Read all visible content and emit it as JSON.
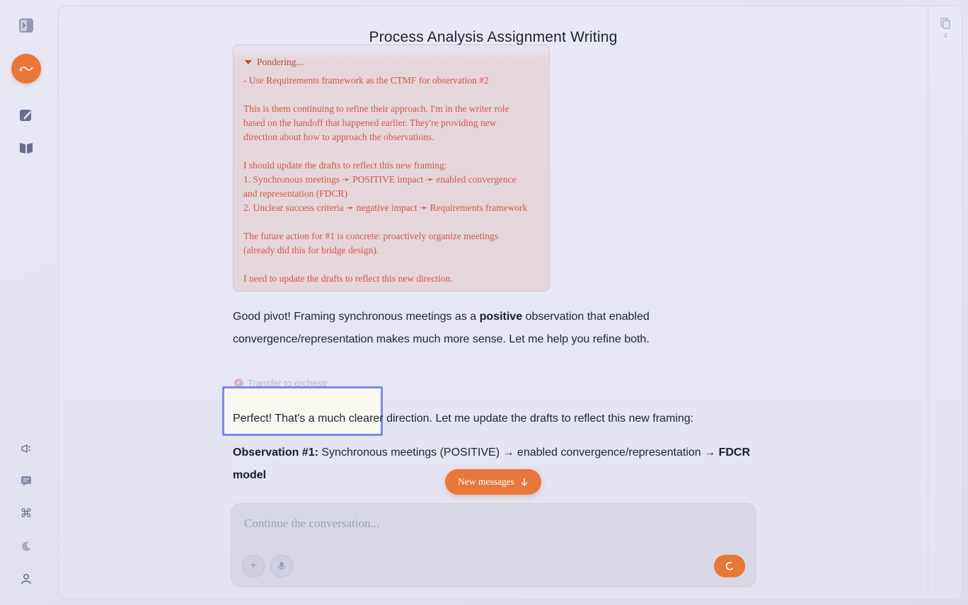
{
  "rail": {
    "icons": [
      "sidebar-toggle-icon",
      "new-chat-icon",
      "compose-icon",
      "library-icon",
      "announcement-icon",
      "feedback-icon",
      "command-icon",
      "moon-icon",
      "user-icon"
    ]
  },
  "header": {
    "title": "Process Analysis Assignment Writing"
  },
  "sidepanel": {
    "count": "4"
  },
  "thinking": {
    "label": "Pondering...",
    "lines": [
      "- Use Requirements framework as the CTMF for observation #2",
      "",
      "This is them continuing to refine their approach. I'm in the writer role",
      "based on the handoff that happened earlier. They're providing new",
      "direction about how to approach the observations.",
      "",
      "I should update the drafts to reflect this new framing:",
      "1. Synchronous meetings ➛ POSITIVE impact ➛ enabled convergence",
      "and representation (FDCR)",
      "2. Unclear success criteria ➛ negative impact ➛ Requirements framework",
      "",
      "The future action for #1 is concrete: proactively organize meetings",
      "(already did this for bridge design).",
      "",
      "I need to update the drafts to reflect this new direction."
    ]
  },
  "messages": {
    "m1_pre": "Good pivot! Framing synchronous meetings as a ",
    "m1_bold": "positive",
    "m1_post": " observation that enabled",
    "m1_line2": "convergence/representation makes much more sense. Let me help you refine both.",
    "tool_label": "Transfer to orchestr",
    "m2_pre": "Perfect! That's a much clearer",
    "m2_post": " direction. Let me update the drafts to reflect this new framing:",
    "obs_label": "Observation #1:",
    "obs_text": " Synchronous meetings (POSITIVE) → enabled convergence/representation → ",
    "obs_bold": "FDCR",
    "obs_line2": "model"
  },
  "new_messages_label": "New messages",
  "composer": {
    "placeholder": "Continue the conversation..."
  },
  "colors": {
    "accent": "#e8773a",
    "highlight": "#8088e8",
    "thinking_text": "#cf5845"
  }
}
